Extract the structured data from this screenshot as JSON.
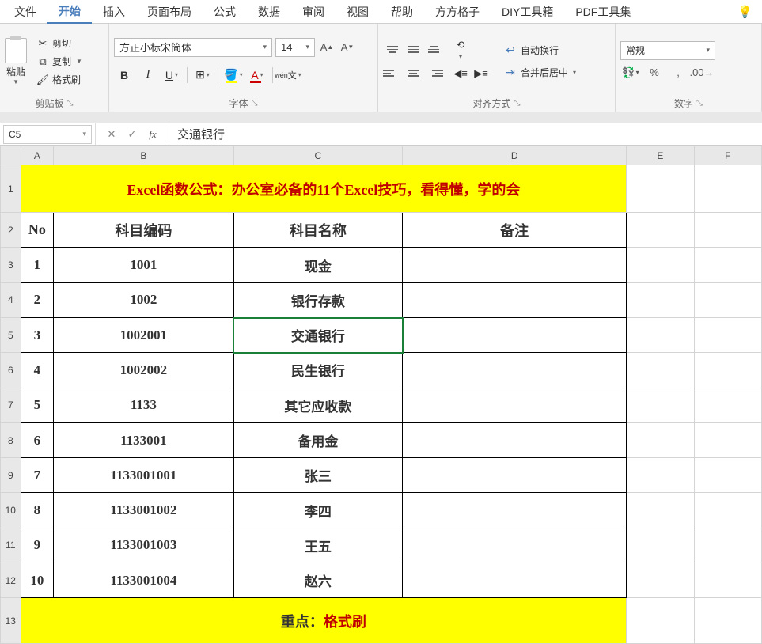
{
  "menu": {
    "items": [
      "文件",
      "开始",
      "插入",
      "页面布局",
      "公式",
      "数据",
      "审阅",
      "视图",
      "帮助",
      "方方格子",
      "DIY工具箱",
      "PDF工具集"
    ],
    "active_index": 1
  },
  "ribbon": {
    "clipboard": {
      "paste": "粘贴",
      "cut": "剪切",
      "copy": "复制",
      "format_painter": "格式刷",
      "group_label": "剪贴板"
    },
    "font": {
      "name": "方正小标宋简体",
      "size": "14",
      "group_label": "字体"
    },
    "alignment": {
      "wrap": "自动换行",
      "merge": "合并后居中",
      "group_label": "对齐方式"
    },
    "number": {
      "format": "常规",
      "group_label": "数字"
    }
  },
  "namebox": "C5",
  "formula": "交通银行",
  "columns": [
    "A",
    "B",
    "C",
    "D",
    "E",
    "F"
  ],
  "sheet": {
    "title": "Excel函数公式：办公室必备的11个Excel技巧，看得懂，学的会",
    "headers": {
      "no": "No",
      "code": "科目编码",
      "name": "科目名称",
      "note": "备注"
    },
    "rows": [
      {
        "no": "1",
        "code": "1001",
        "name": "现金",
        "note": ""
      },
      {
        "no": "2",
        "code": "1002",
        "name": "银行存款",
        "note": ""
      },
      {
        "no": "3",
        "code": "1002001",
        "name": "交通银行",
        "note": ""
      },
      {
        "no": "4",
        "code": "1002002",
        "name": "民生银行",
        "note": ""
      },
      {
        "no": "5",
        "code": "1133",
        "name": "其它应收款",
        "note": ""
      },
      {
        "no": "6",
        "code": "1133001",
        "name": "备用金",
        "note": ""
      },
      {
        "no": "7",
        "code": "1133001001",
        "name": "张三",
        "note": ""
      },
      {
        "no": "8",
        "code": "1133001002",
        "name": "李四",
        "note": ""
      },
      {
        "no": "9",
        "code": "1133001003",
        "name": "王五",
        "note": ""
      },
      {
        "no": "10",
        "code": "1133001004",
        "name": "赵六",
        "note": ""
      }
    ],
    "footer_prefix": "重点：",
    "footer_highlight": "格式刷"
  }
}
